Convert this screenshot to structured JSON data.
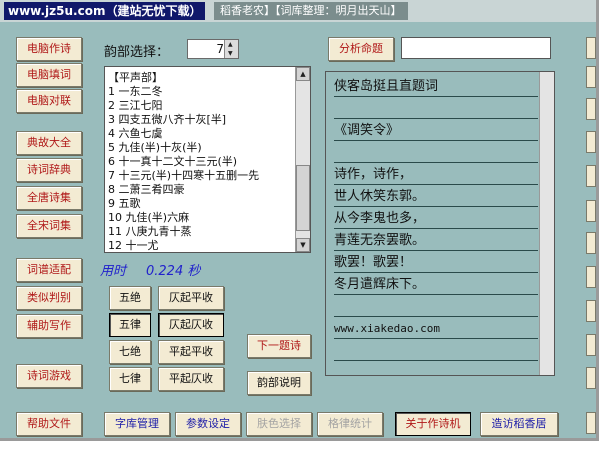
{
  "titlebar": {
    "site": "www.jz5u.com（建站无忧下载）",
    "rest": "稻香老农】【词库整理：明月出天山】"
  },
  "left_nav": {
    "items": [
      {
        "label": "电脑作诗",
        "pressed": true
      },
      {
        "label": "电脑填词",
        "pressed": false
      },
      {
        "label": "电脑对联",
        "pressed": false
      },
      {
        "label": "典故大全",
        "pressed": false
      },
      {
        "label": "诗词辞典",
        "pressed": false
      },
      {
        "label": "全唐诗集",
        "pressed": false
      },
      {
        "label": "全宋词集",
        "pressed": false
      },
      {
        "label": "词谱适配",
        "pressed": false
      },
      {
        "label": "类似判别",
        "pressed": false
      },
      {
        "label": "辅助写作",
        "pressed": false
      },
      {
        "label": "诗词游戏",
        "pressed": false
      },
      {
        "label": "帮助文件",
        "pressed": false
      }
    ]
  },
  "rhyme": {
    "label": "韵部选择：",
    "value": "7",
    "list": [
      "【平声部】",
      "1 一东二冬",
      "2 三江七阳",
      "3 四支五微八齐十灰[半]",
      "4 六鱼七虞",
      "5 九佳(半)十灰(半)",
      "6 十一真十二文十三元(半)",
      "7 十三元(半)十四寒十五删一先",
      "8 二萧三肴四豪",
      "9 五歌",
      "10 九佳(半)六麻",
      "11 八庚九青十蒸",
      "12 十一尤"
    ]
  },
  "timing": {
    "label": "用时",
    "value": "0.224 秒"
  },
  "form_buttons": [
    {
      "label": "五绝",
      "pressed": false
    },
    {
      "label": "仄起平收",
      "pressed": false
    },
    {
      "label": "五律",
      "pressed": true
    },
    {
      "label": "仄起仄收",
      "pressed": true
    },
    {
      "label": "七绝",
      "pressed": false
    },
    {
      "label": "平起平收",
      "pressed": false
    },
    {
      "label": "七律",
      "pressed": false
    },
    {
      "label": "平起仄收",
      "pressed": false
    }
  ],
  "actions": {
    "analyze": "分析命题",
    "analyze_value": "",
    "next": "下一题诗",
    "rhyme_help": "韵部说明"
  },
  "poem": {
    "lines": [
      "侠客岛挺且直题词",
      "",
      "《调笑令》",
      "",
      "诗作，诗作，",
      "世人休笑东郭。",
      "从今李鬼也多，",
      "青莲无奈罢歌。",
      "歌罢！歌罢！",
      "冬月遣辉床下。",
      "",
      "www.xiakedao.com",
      "",
      ""
    ]
  },
  "bottom_bar": [
    {
      "label": "字库管理",
      "state": "blue"
    },
    {
      "label": "参数设定",
      "state": "blue"
    },
    {
      "label": "肤色选择",
      "state": "gray"
    },
    {
      "label": "格律统计",
      "state": "gray"
    },
    {
      "label": "关于作诗机",
      "state": "pressed"
    },
    {
      "label": "造访稻香居",
      "state": "blue"
    }
  ],
  "right_edge": [
    "",
    "",
    "",
    "",
    "",
    "",
    "",
    "",
    "",
    "",
    "",
    ""
  ]
}
